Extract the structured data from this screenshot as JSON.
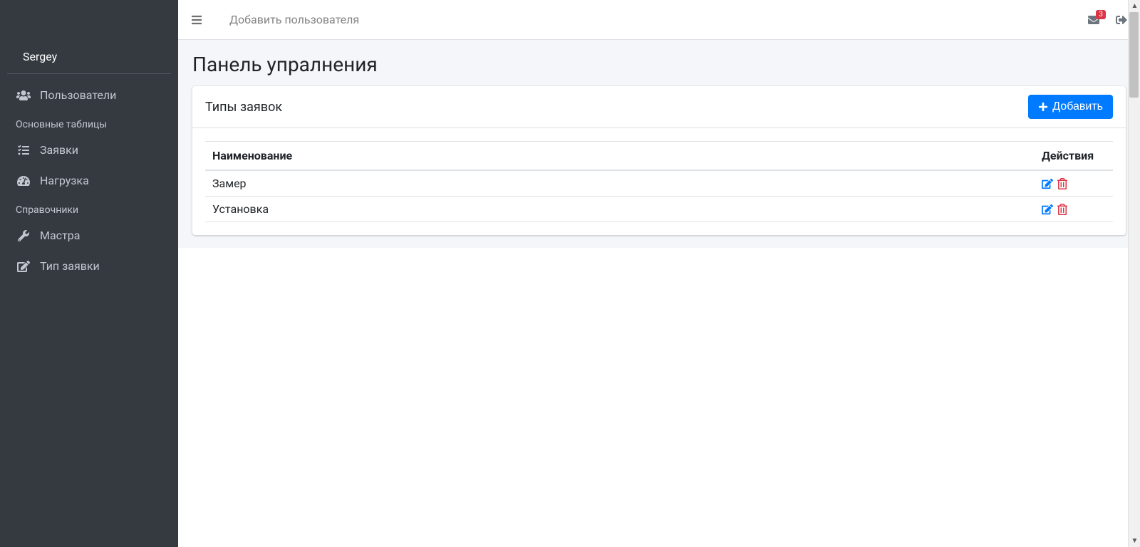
{
  "sidebar": {
    "user_name": "Sergey",
    "nav_users": "Пользователи",
    "section_main_tables": "Основные таблицы",
    "nav_requests": "Заявки",
    "nav_load": "Нагрузка",
    "section_references": "Справочники",
    "nav_masters": "Мастра",
    "nav_request_type": "Тип заявки"
  },
  "topbar": {
    "add_user_link": "Добавить пользователя",
    "mail_badge": "3"
  },
  "page": {
    "title": "Панель упралнения"
  },
  "card": {
    "title": "Типы заявок",
    "add_button": "Добавить",
    "columns": {
      "name": "Наименование",
      "actions": "Действия"
    },
    "rows": [
      {
        "name": "Замер"
      },
      {
        "name": "Установка"
      }
    ]
  }
}
